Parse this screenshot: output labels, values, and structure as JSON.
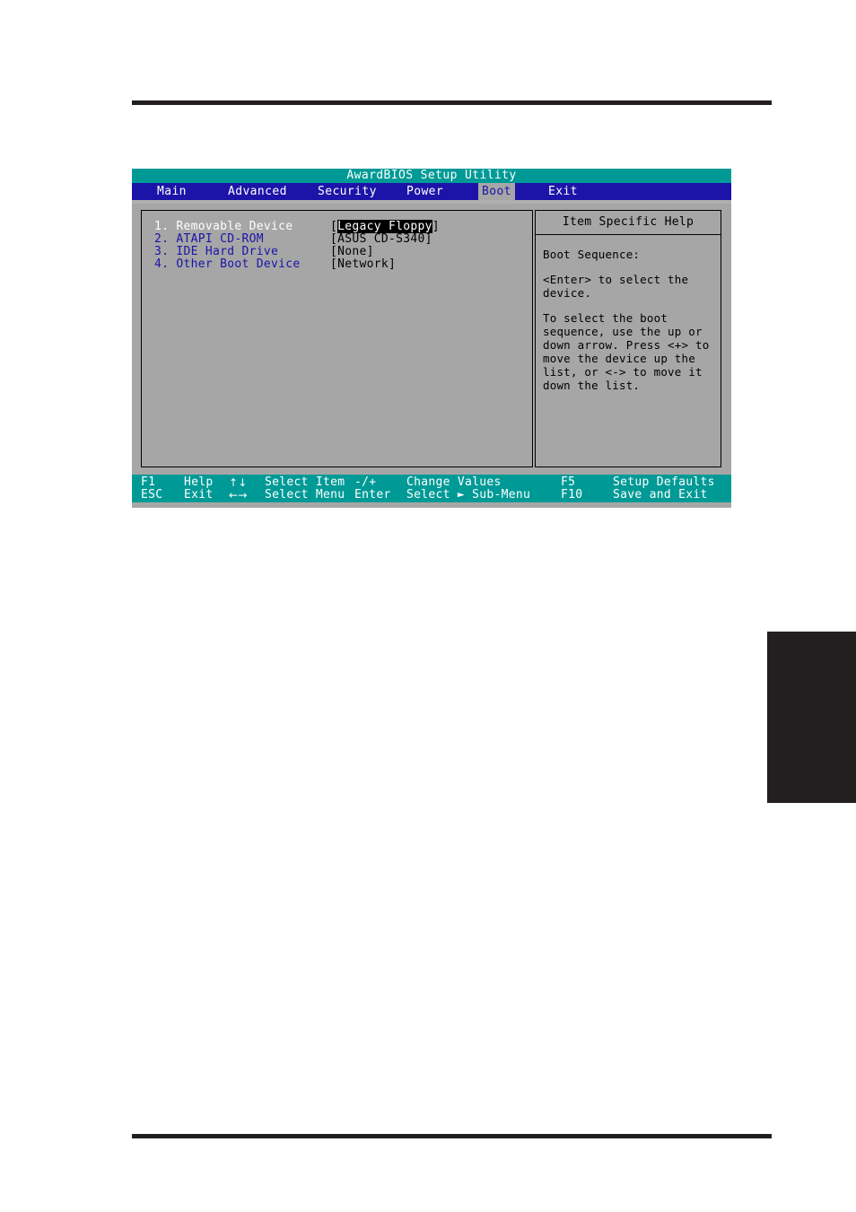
{
  "window": {
    "title": "AwardBIOS Setup Utility",
    "menu_tabs": [
      {
        "label": "Main",
        "selected": false
      },
      {
        "label": "Advanced",
        "selected": false
      },
      {
        "label": "Security",
        "selected": false
      },
      {
        "label": "Power",
        "selected": false
      },
      {
        "label": "Boot",
        "selected": true
      },
      {
        "label": "Exit",
        "selected": false
      }
    ]
  },
  "boot_list": {
    "items": [
      {
        "num": "1.",
        "label": "Removable Device",
        "value": "Legacy Floppy",
        "highlighted": true,
        "selected_row": true
      },
      {
        "num": "2.",
        "label": "ATAPI CD-ROM",
        "value": "ASUS CD-S340",
        "highlighted": false,
        "selected_row": false
      },
      {
        "num": "3.",
        "label": "IDE Hard Drive",
        "value": "None",
        "highlighted": false,
        "selected_row": false
      },
      {
        "num": "4.",
        "label": "Other Boot Device",
        "value": "Network",
        "highlighted": false,
        "selected_row": false
      }
    ]
  },
  "help": {
    "title": "Item Specific Help",
    "paragraphs": [
      "Boot Sequence:",
      "<Enter> to select the\ndevice.",
      "To select the boot\nsequence, use the up or\ndown arrow. Press <+> to\nmove the device up the\nlist, or <-> to move it\ndown the list."
    ]
  },
  "key_bar": {
    "row1": [
      {
        "key": "F1",
        "action": "Help"
      },
      {
        "key": "↑↓",
        "action": "Select Item"
      },
      {
        "key": "-/+",
        "action": "Change Values"
      },
      {
        "key": "F5",
        "action": "Setup Defaults"
      }
    ],
    "row2": [
      {
        "key": "ESC",
        "action": "Exit"
      },
      {
        "key": "←→",
        "action": "Select Menu"
      },
      {
        "key": "Enter",
        "action": "Select ► Sub-Menu"
      },
      {
        "key": "F10",
        "action": "Save and Exit"
      }
    ]
  },
  "colors": {
    "title_bar": "#009a96",
    "menu_bar": "#1c14a8",
    "panel": "#a6a6a6",
    "label_blue": "#1c14a8",
    "key_bar": "#009a96",
    "rule": "#231f20"
  }
}
